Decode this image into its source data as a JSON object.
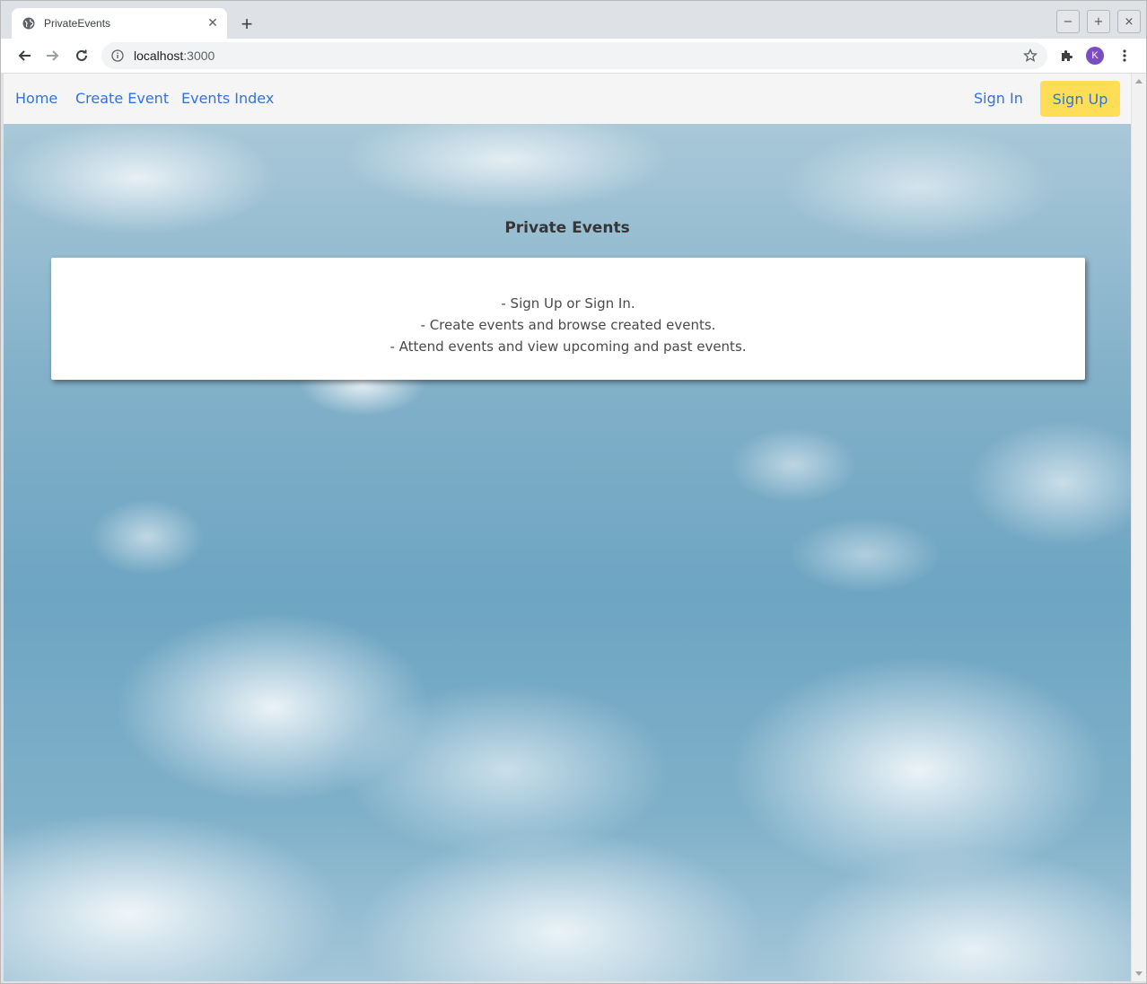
{
  "browser": {
    "tab_title": "PrivateEvents",
    "url_host": "localhost",
    "url_port": ":3000",
    "profile_initial": "K",
    "window_buttons": [
      "−",
      "+",
      "×"
    ]
  },
  "navbar": {
    "home": "Home",
    "create_event": "Create Event",
    "events_index": "Events Index",
    "sign_in": "Sign In",
    "sign_up": "Sign Up"
  },
  "main": {
    "title": "Private Events",
    "features": [
      "- Sign Up or Sign In.",
      "- Create events and browse created events.",
      "- Attend events and view upcoming and past events."
    ]
  },
  "colors": {
    "link": "#3273dc",
    "signup_bg": "#ffdd57",
    "navbar_bg": "#f5f5f5"
  }
}
